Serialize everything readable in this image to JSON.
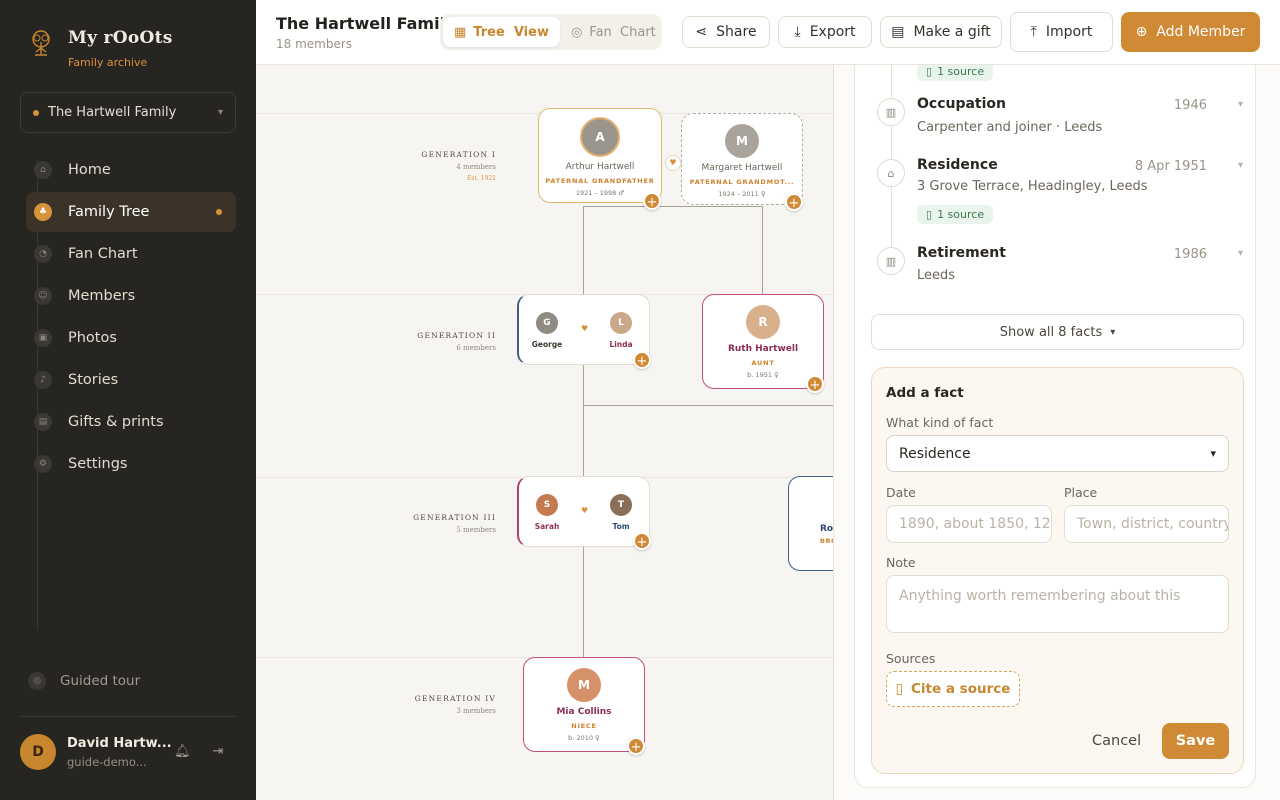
{
  "brand": {
    "name": "My rOoOts",
    "subtitle": "Family archive",
    "logo_icon": "tree-logo-icon"
  },
  "family_selector": {
    "value": "The Hartwell Family"
  },
  "nav": [
    {
      "label": "Home",
      "icon": "home-icon",
      "active": false
    },
    {
      "label": "Family Tree",
      "icon": "tree-icon",
      "active": true
    },
    {
      "label": "Fan Chart",
      "icon": "fan-chart-icon",
      "active": false
    },
    {
      "label": "Members",
      "icon": "members-icon",
      "active": false
    },
    {
      "label": "Photos",
      "icon": "photos-icon",
      "active": false
    },
    {
      "label": "Stories",
      "icon": "stories-icon",
      "active": false
    },
    {
      "label": "Gifts & prints",
      "icon": "gift-icon",
      "active": false
    },
    {
      "label": "Settings",
      "icon": "gear-icon",
      "active": false
    }
  ],
  "guided_tour": {
    "label": "Guided tour"
  },
  "user": {
    "initial": "D",
    "name": "David Hartw...",
    "email": "guide-demo..."
  },
  "header": {
    "title": "The Hartwell Family",
    "subtitle": "18 members",
    "view_toggle": {
      "tree": "Tree  View",
      "fan": "Fan  Chart"
    },
    "share": "Share",
    "export": "Export",
    "gift": "Make a gift",
    "import": "Import",
    "add_member": "Add Member"
  },
  "tree": {
    "generations": [
      {
        "label": "GENERATION I",
        "count": "4 members",
        "extra": "Est. 1921"
      },
      {
        "label": "GENERATION II",
        "count": "6 members"
      },
      {
        "label": "GENERATION III",
        "count": "5 members"
      },
      {
        "label": "GENERATION IV",
        "count": "3 members"
      }
    ],
    "arthur": {
      "name": "Arthur Hartwell",
      "role": "PATERNAL GRANDFATHER",
      "years": "1921 – 1998 ♂"
    },
    "margaret": {
      "name": "Margaret Hartwell",
      "role": "PATERNAL GRANDMOT...",
      "years": "1924 – 2011 ♀"
    },
    "george": {
      "name": "George"
    },
    "linda": {
      "name": "Linda"
    },
    "ruth": {
      "name": "Ruth Hartwell",
      "role": "AUNT",
      "years": "b. 1951 ♀"
    },
    "sarah": {
      "name": "Sarah"
    },
    "tom": {
      "name": "Tom"
    },
    "rob": {
      "name": "Ro",
      "role": "BRO"
    },
    "mia": {
      "name": "Mia Collins",
      "role": "NIECE",
      "years": "b. 2010 ♀"
    },
    "heart": "♥",
    "plus": "+"
  },
  "facts": {
    "top_source": "1 source",
    "items": [
      {
        "title": "Occupation",
        "date": "1946",
        "detail": "Carpenter and joiner · Leeds"
      },
      {
        "title": "Residence",
        "date": "8 Apr 1951",
        "detail": "3 Grove Terrace, Headingley, Leeds",
        "source": "1 source"
      },
      {
        "title": "Retirement",
        "date": "1986",
        "detail": "Leeds"
      }
    ],
    "show_all": "Show all 8 facts"
  },
  "add_fact": {
    "title": "Add a fact",
    "kind_label": "What kind of fact",
    "kind_value": "Residence",
    "date_label": "Date",
    "date_placeholder": "1890, about 1850, 12",
    "place_label": "Place",
    "place_placeholder": "Town, district, country",
    "note_label": "Note",
    "note_placeholder": "Anything worth remembering about this",
    "sources_label": "Sources",
    "cite": "Cite a source",
    "cancel": "Cancel",
    "save": "Save"
  },
  "colors": {
    "accent": "#d08a35",
    "sidebar": "#262521",
    "canvas": "#f7f5f1",
    "female_border": "#b03f6a",
    "male_border": "#3f5f8c"
  }
}
